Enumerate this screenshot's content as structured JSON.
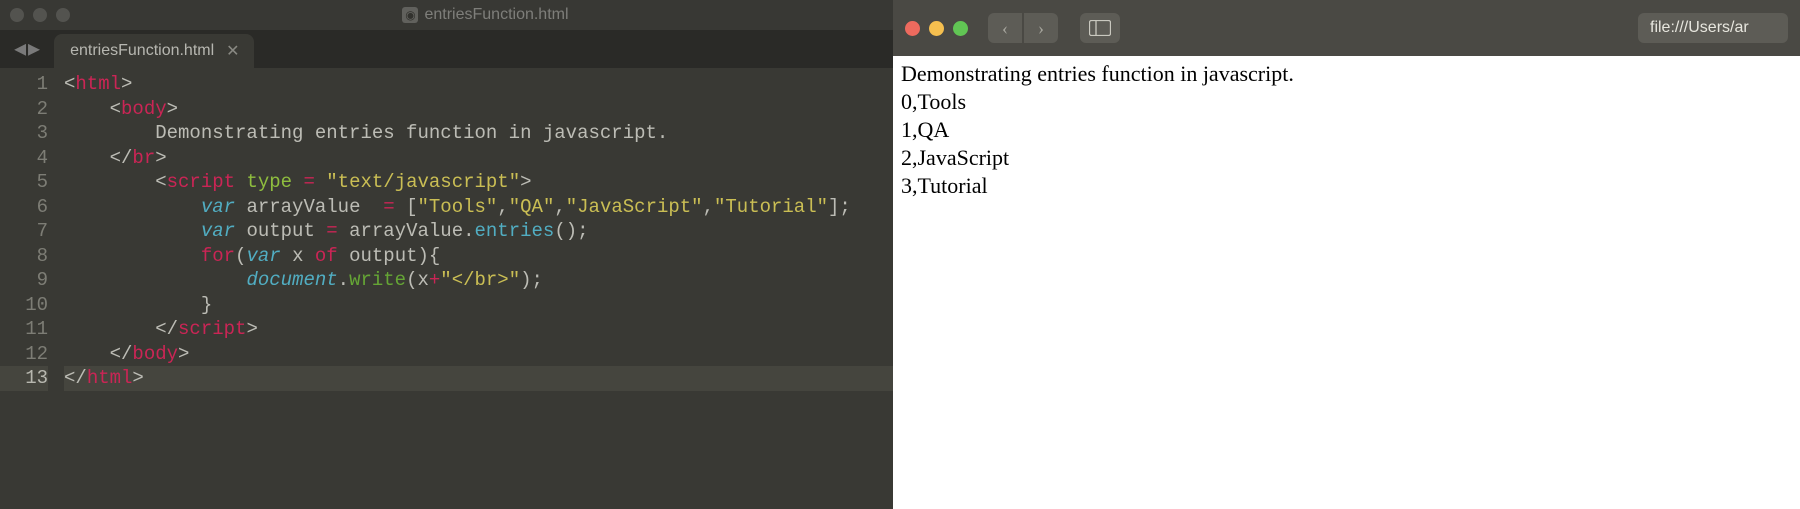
{
  "editor": {
    "window_title": "entriesFunction.html",
    "tab_name": "entriesFunction.html",
    "line_count": 13,
    "current_line": 13,
    "code_tokens": [
      [
        [
          "pn",
          "<"
        ],
        [
          "pk",
          "html"
        ],
        [
          "pn",
          ">"
        ]
      ],
      [
        [
          "pn",
          "    <"
        ],
        [
          "pk",
          "body"
        ],
        [
          "pn",
          ">"
        ]
      ],
      [
        [
          "pn",
          "        Demonstrating entries function in javascript."
        ]
      ],
      [
        [
          "pn",
          "    </"
        ],
        [
          "pk",
          "br"
        ],
        [
          "pn",
          ">"
        ]
      ],
      [
        [
          "pn",
          "        <"
        ],
        [
          "pk",
          "script"
        ],
        [
          "pn",
          " "
        ],
        [
          "at",
          "type"
        ],
        [
          "pn",
          " "
        ],
        [
          "op",
          "="
        ],
        [
          "pn",
          " "
        ],
        [
          "st",
          "\"text/javascript\""
        ],
        [
          "pn",
          ">"
        ]
      ],
      [
        [
          "pn",
          "            "
        ],
        [
          "kw",
          "var"
        ],
        [
          "pn",
          " arrayValue  "
        ],
        [
          "op",
          "="
        ],
        [
          "pn",
          " ["
        ],
        [
          "st",
          "\"Tools\""
        ],
        [
          "pn",
          ","
        ],
        [
          "st",
          "\"QA\""
        ],
        [
          "pn",
          ","
        ],
        [
          "st",
          "\"JavaScript\""
        ],
        [
          "pn",
          ","
        ],
        [
          "st",
          "\"Tutorial\""
        ],
        [
          "pn",
          "];"
        ]
      ],
      [
        [
          "pn",
          "            "
        ],
        [
          "kw",
          "var"
        ],
        [
          "pn",
          " output "
        ],
        [
          "op",
          "="
        ],
        [
          "pn",
          " arrayValue."
        ],
        [
          "fn",
          "entries"
        ],
        [
          "pn",
          "();"
        ]
      ],
      [
        [
          "pn",
          "            "
        ],
        [
          "pk",
          "for"
        ],
        [
          "pn",
          "("
        ],
        [
          "kw",
          "var"
        ],
        [
          "pn",
          " x "
        ],
        [
          "pk",
          "of"
        ],
        [
          "pn",
          " output){"
        ]
      ],
      [
        [
          "pn",
          "                "
        ],
        [
          "kw",
          "document"
        ],
        [
          "pn",
          "."
        ],
        [
          "id",
          "write"
        ],
        [
          "pn",
          "(x"
        ],
        [
          "op",
          "+"
        ],
        [
          "st",
          "\"</br>\""
        ],
        [
          "pn",
          ");"
        ]
      ],
      [
        [
          "pn",
          "            }"
        ]
      ],
      [
        [
          "pn",
          "        </"
        ],
        [
          "pk",
          "script"
        ],
        [
          "pn",
          ">"
        ]
      ],
      [
        [
          "pn",
          "    </"
        ],
        [
          "pk",
          "body"
        ],
        [
          "pn",
          ">"
        ]
      ],
      [
        [
          "pn",
          "</"
        ],
        [
          "pk",
          "html"
        ],
        [
          "pn",
          ">"
        ]
      ]
    ]
  },
  "browser": {
    "address": "file:///Users/ar",
    "output_lines": [
      "Demonstrating entries function in javascript.",
      "0,Tools",
      "1,QA",
      "2,JavaScript",
      "3,Tutorial"
    ]
  }
}
